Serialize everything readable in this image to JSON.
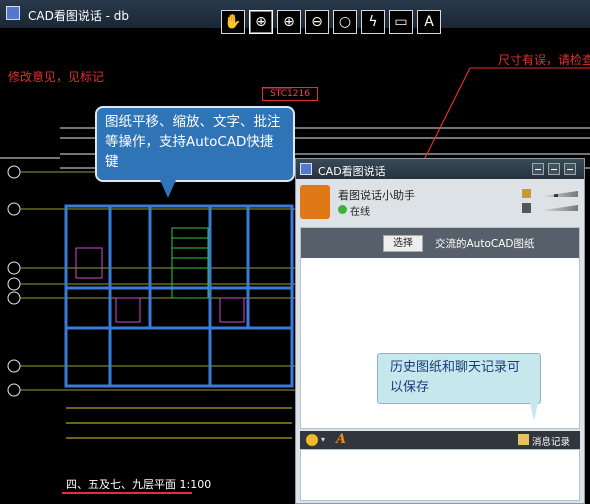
{
  "window": {
    "title": "CAD看图说话 - db"
  },
  "annotations": {
    "left_note": "修改意见，见标记",
    "right_note": "尺寸有误，请检查",
    "tag": "STC1216",
    "bottom_caption": "四、五及七、九层平面   1:100"
  },
  "toolbar": {
    "buttons": [
      {
        "name": "pan-tool",
        "glyph": "✋"
      },
      {
        "name": "zoom-window-tool",
        "glyph": "⊕"
      },
      {
        "name": "zoom-in-tool",
        "glyph": "⊕"
      },
      {
        "name": "zoom-out-tool",
        "glyph": "⊖"
      },
      {
        "name": "circle-tool",
        "glyph": "○"
      },
      {
        "name": "lightning-tool",
        "glyph": "ϟ"
      },
      {
        "name": "speech-bubble-tool",
        "glyph": "▭"
      },
      {
        "name": "text-tool",
        "glyph": "A"
      }
    ]
  },
  "callouts": {
    "blue": "图纸平移、缩放、文字、批注等操作，支持AutoCAD快捷键",
    "teal": "历史图纸和聊天记录可以保存"
  },
  "chat": {
    "title": "CAD看图说话",
    "contact_name": "看图说话小助手",
    "status": "在线",
    "select_button": "选择",
    "file_label": "交流的AutoCAD图纸",
    "record_label": "消息记录"
  },
  "colors": {
    "annotation_red": "#e03030",
    "callout_blue": "#2f74b7",
    "callout_teal": "#c6e8ed",
    "wall_blue": "#3a7ad8",
    "dim_white": "#e8e8e8"
  }
}
